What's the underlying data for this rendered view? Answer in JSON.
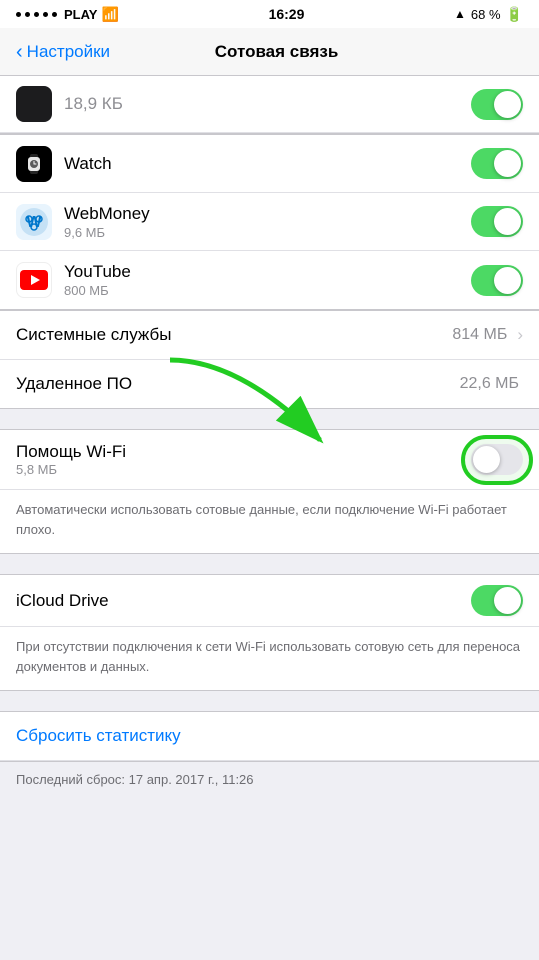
{
  "statusBar": {
    "carrier": "PLAY",
    "time": "16:29",
    "battery": "68 %",
    "signal_dots": 5
  },
  "navBar": {
    "back_label": "Настройки",
    "title": "Сотовая связь"
  },
  "topRow": {
    "size": "18,9 КБ"
  },
  "appRows": [
    {
      "name": "Watch",
      "subtitle": "",
      "icon_type": "watch",
      "toggle": true
    },
    {
      "name": "WebMoney",
      "subtitle": "9,6 МБ",
      "icon_type": "webmoney",
      "toggle": true
    },
    {
      "name": "YouTube",
      "subtitle": "800 МБ",
      "icon_type": "youtube",
      "toggle": true
    }
  ],
  "systemServices": {
    "label": "Системные службы",
    "value": "814 МБ"
  },
  "remoteManagement": {
    "label": "Удаленное ПО",
    "value": "22,6 МБ"
  },
  "wifiAssist": {
    "title": "Помощь Wi-Fi",
    "subtitle": "5,8 МБ",
    "toggle": false,
    "description": "Автоматически использовать сотовые данные, если подключение Wi-Fi работает плохо."
  },
  "icloudDrive": {
    "title": "iCloud Drive",
    "toggle": true,
    "description": "При отсутствии подключения к сети Wi-Fi использовать сотовую сеть для переноса документов и данных."
  },
  "resetStats": {
    "button_label": "Сбросить статистику",
    "last_reset": "Последний сброс: 17 апр. 2017 г., 11:26"
  }
}
